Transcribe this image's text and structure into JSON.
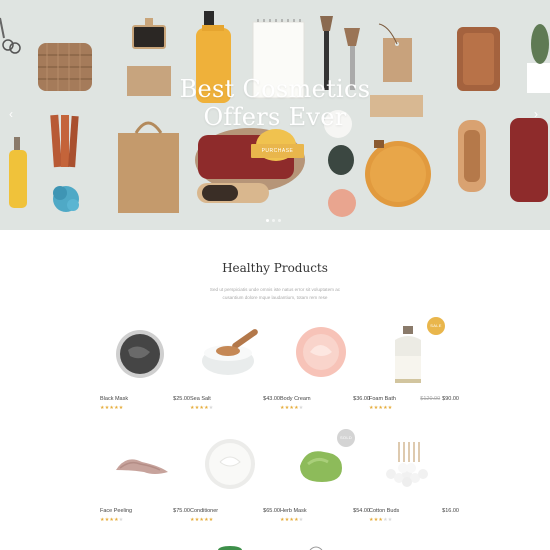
{
  "hero": {
    "title_line1": "Best Cosmetics",
    "title_line2": "Offers Ever",
    "button_label": "PURCHASE",
    "prev_arrow": "‹",
    "next_arrow": "›",
    "slide_count": 3,
    "active_slide": 1
  },
  "section": {
    "title": "Healthy Products",
    "subtitle_line1": "Sed ut perspiciatis unde omnis iste natus error sit voluptatem ac",
    "subtitle_line2": "cusantium dolore mque laudantium, totam rem rese"
  },
  "products": [
    {
      "name": "Black Mask",
      "price": "$25.00",
      "old_price": "",
      "rating": 5,
      "badge": ""
    },
    {
      "name": "Sea Salt",
      "price": "$43.00",
      "old_price": "",
      "rating": 4,
      "badge": ""
    },
    {
      "name": "Body Cream",
      "price": "$36.00",
      "old_price": "",
      "rating": 4,
      "badge": ""
    },
    {
      "name": "Foam Bath",
      "price": "$90.00",
      "old_price": "$120.00",
      "rating": 5,
      "badge": "SALE"
    },
    {
      "name": "Face Peeling",
      "price": "$75.00",
      "old_price": "",
      "rating": 4,
      "badge": ""
    },
    {
      "name": "Conditioner",
      "price": "$65.00",
      "old_price": "",
      "rating": 5,
      "badge": ""
    },
    {
      "name": "Herb Mask",
      "price": "$54.00",
      "old_price": "",
      "rating": 4,
      "badge": "SOLD"
    },
    {
      "name": "Cotton Buds",
      "price": "$16.00",
      "old_price": "",
      "rating": 3,
      "badge": ""
    }
  ],
  "colors": {
    "accent": "#e9b64c",
    "hero_background": "#dfe4e1",
    "star_on": "#e6ad3c",
    "sale_badge": "#e9b64c",
    "sold_badge": "#d4d4d4"
  },
  "icons": {
    "prev": "chevron-left-icon",
    "next": "chevron-right-icon",
    "star": "star-icon"
  }
}
